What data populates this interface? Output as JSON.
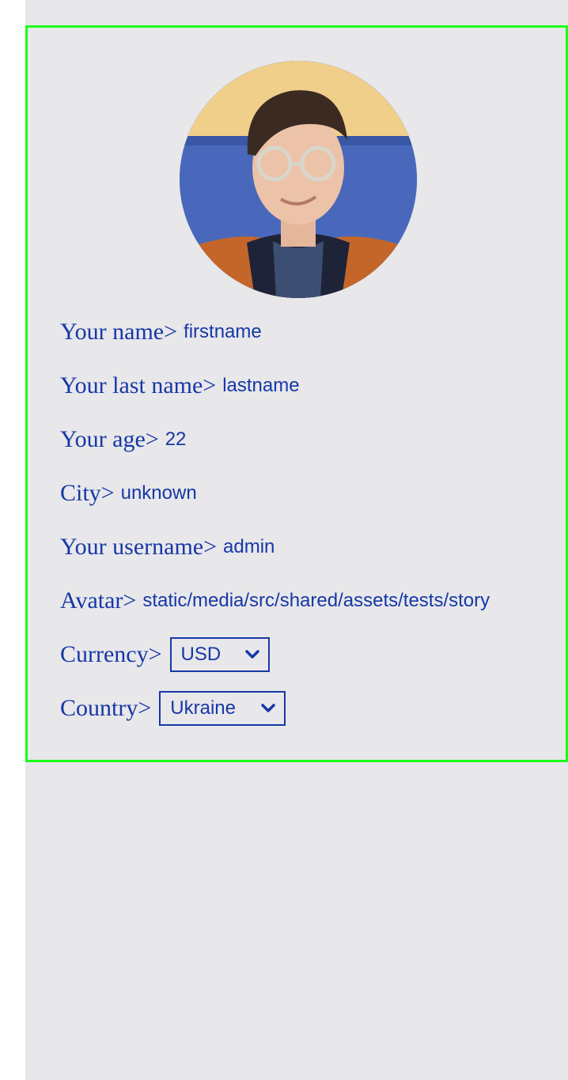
{
  "profile": {
    "fields": [
      {
        "label": "Your name>",
        "value": "firstname"
      },
      {
        "label": "Your last name>",
        "value": "lastname"
      },
      {
        "label": "Your age>",
        "value": "22"
      },
      {
        "label": "City>",
        "value": "unknown"
      },
      {
        "label": "Your username>",
        "value": "admin"
      },
      {
        "label": "Avatar>",
        "value": "static/media/src/shared/assets/tests/story"
      }
    ],
    "currency": {
      "label": "Currency>",
      "selected": "USD"
    },
    "country": {
      "label": "Country>",
      "selected": "Ukraine"
    }
  },
  "colors": {
    "accent": "#1638a6",
    "card_border": "#19ff19",
    "background": "#e8e7ea"
  },
  "icons": {
    "select_arrow": "chevron-down-icon"
  }
}
